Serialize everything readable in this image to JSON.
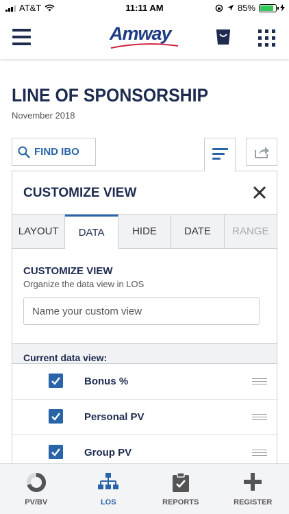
{
  "status_bar": {
    "carrier": "AT&T",
    "time": "11:11 AM",
    "battery": "85%"
  },
  "header": {
    "logo_text": "Amway"
  },
  "page": {
    "title": "LINE OF SPONSORSHIP",
    "subtitle": "November 2018"
  },
  "toolbar": {
    "find_label": "FIND IBO"
  },
  "panel": {
    "title": "CUSTOMIZE VIEW",
    "tabs": [
      {
        "label": "LAYOUT"
      },
      {
        "label": "DATA"
      },
      {
        "label": "HIDE"
      },
      {
        "label": "DATE"
      },
      {
        "label": "RANGE"
      }
    ],
    "active_tab": "DATA",
    "section_title": "CUSTOMIZE VIEW",
    "section_subtitle": "Organize the data view in LOS",
    "name_input_placeholder": "Name your custom view",
    "current_label": "Current data view:",
    "items": [
      {
        "label": "Bonus %",
        "checked": true
      },
      {
        "label": "Personal PV",
        "checked": true
      },
      {
        "label": "Group PV",
        "checked": true
      }
    ]
  },
  "bottom_nav": [
    {
      "label": "PV/BV",
      "icon": "ring-chart-icon"
    },
    {
      "label": "LOS",
      "icon": "org-tree-icon"
    },
    {
      "label": "REPORTS",
      "icon": "clipboard-check-icon"
    },
    {
      "label": "REGISTER",
      "icon": "plus-icon"
    }
  ],
  "colors": {
    "navy": "#1d2b4f",
    "accent_blue": "#2a64a8",
    "battery_green": "#35c759"
  }
}
